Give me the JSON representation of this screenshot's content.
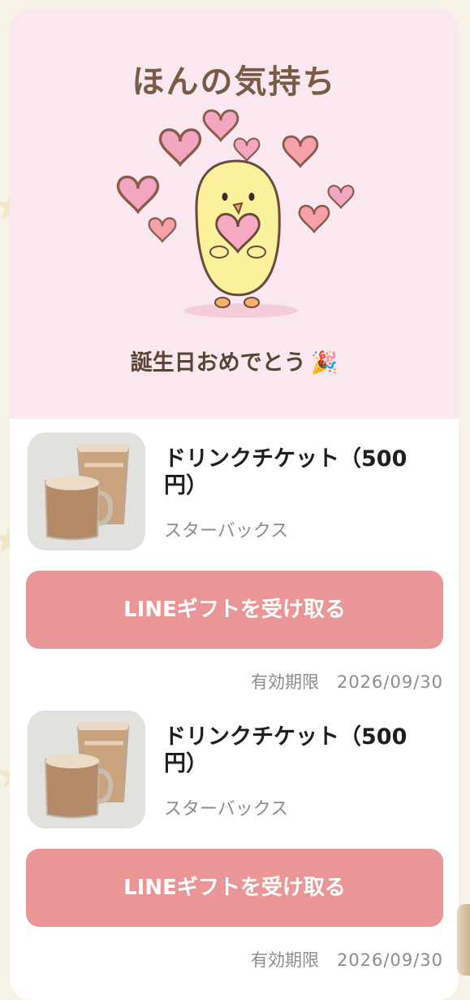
{
  "message_card": {
    "title": "ほんの気持ち",
    "message": "誕生日おめでとう",
    "message_emoji": "🎉"
  },
  "gifts": [
    {
      "name": "ドリンクチケット（500円）",
      "brand": "スターバックス",
      "button_label": "LINEギフトを受け取る",
      "expiry_label": "有効期限",
      "expiry_date": "2026/09/30"
    },
    {
      "name": "ドリンクチケット（500円）",
      "brand": "スターバックス",
      "button_label": "LINEギフトを受け取る",
      "expiry_label": "有効期限",
      "expiry_date": "2026/09/30"
    }
  ],
  "colors": {
    "hero_background": "#fbe7ef",
    "button": "#eb9696",
    "heart_pink": "#f3a6bf",
    "chick_yellow": "#fbf19d"
  }
}
